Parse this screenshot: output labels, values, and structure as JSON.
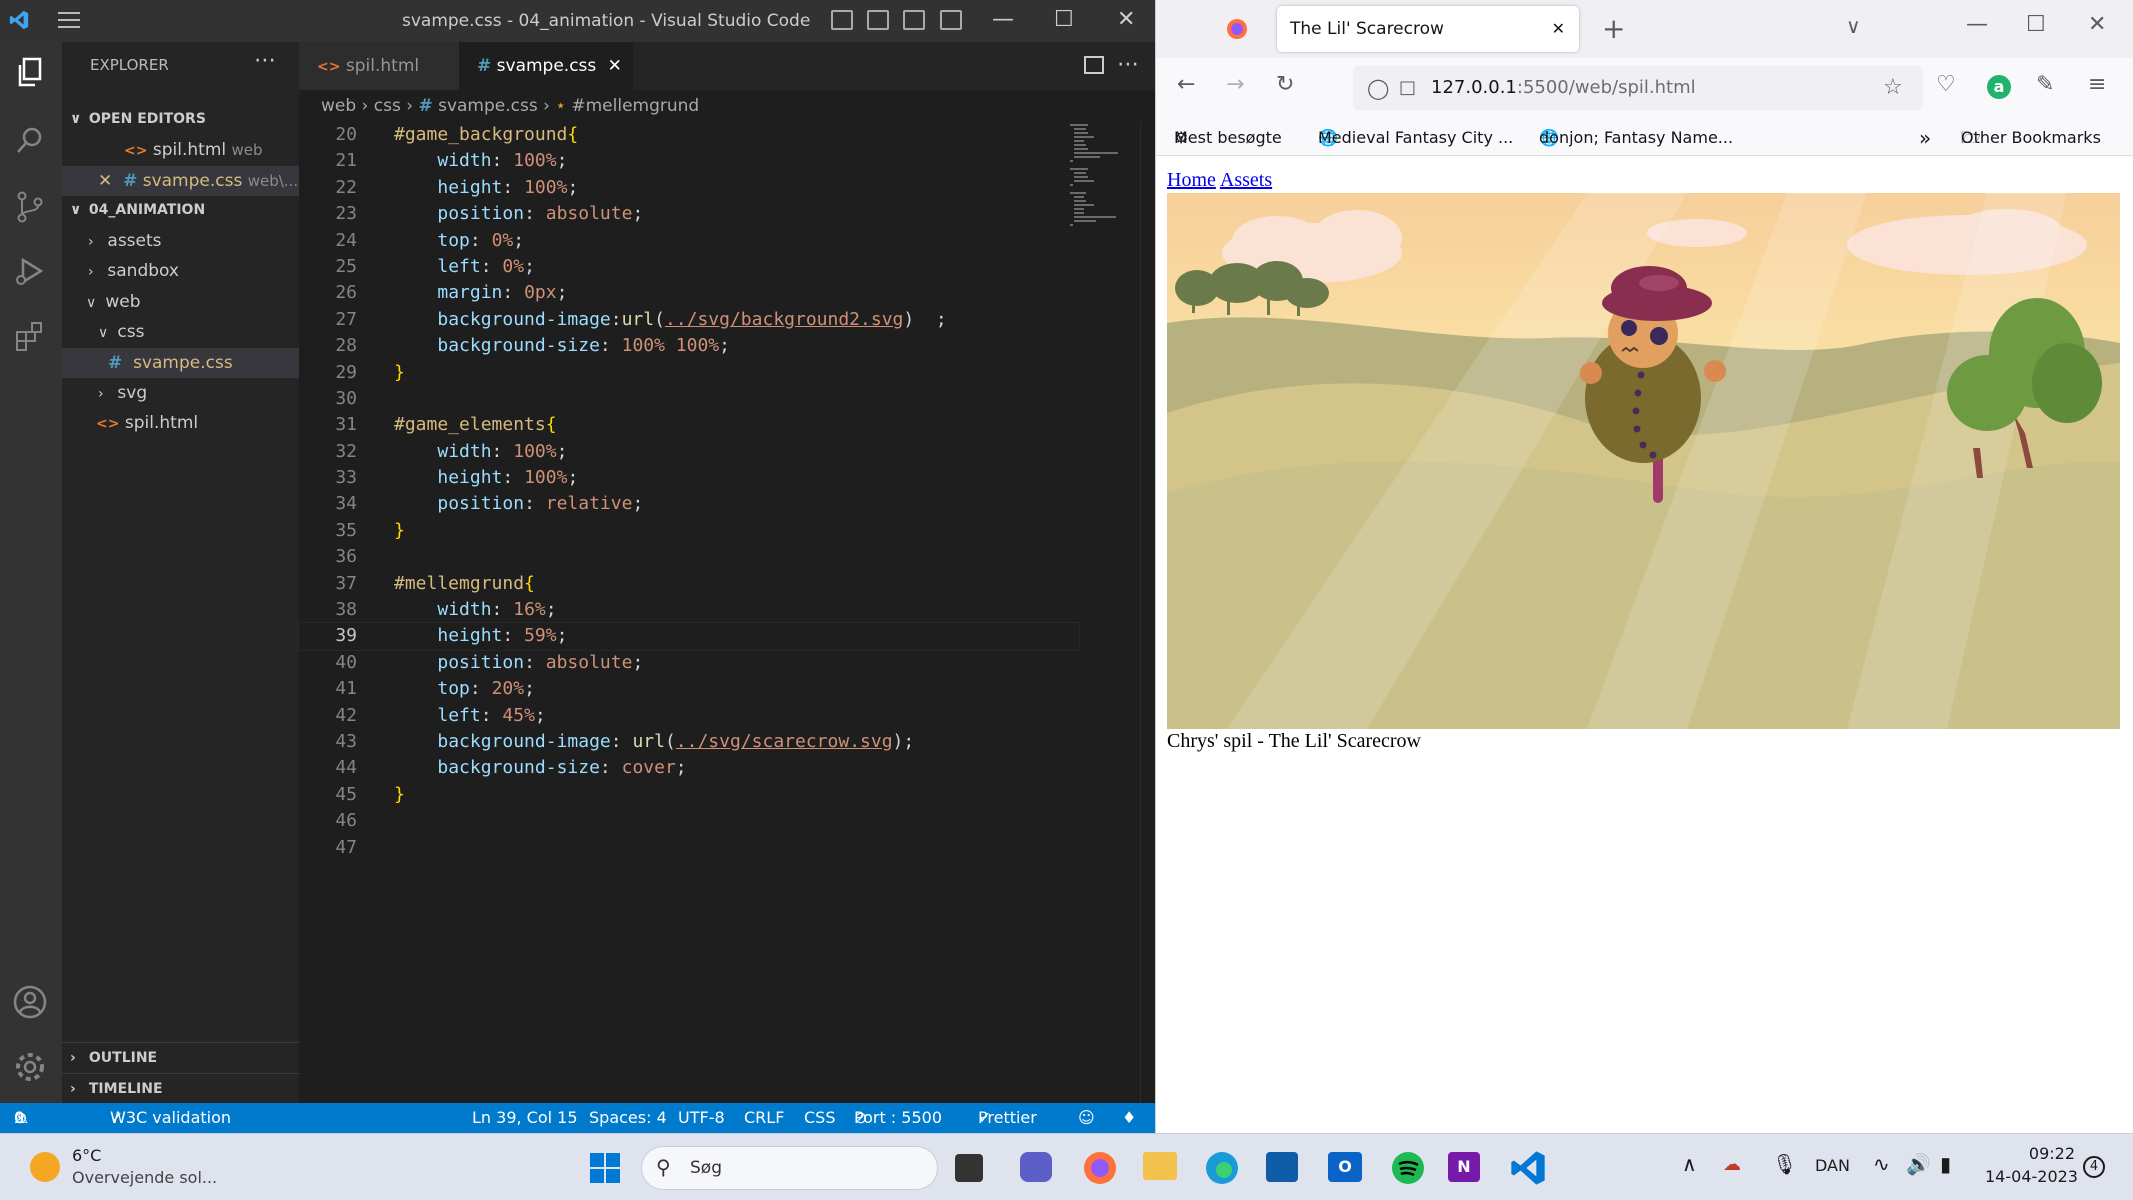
{
  "vscode": {
    "window_title": "svampe.css - 04_animation - Visual Studio Code",
    "explorer": {
      "header": "EXPLORER",
      "open_editors_label": "OPEN EDITORS",
      "open_editors": [
        {
          "name": "spil.html",
          "path": "web"
        },
        {
          "name": "svampe.css",
          "path": "web\\..."
        }
      ],
      "project_label": "04_ANIMATION",
      "tree": {
        "assets": "assets",
        "sandbox": "sandbox",
        "web": "web",
        "css": "css",
        "svampe": "svampe.css",
        "svg": "svg",
        "spil": "spil.html"
      },
      "outline_label": "OUTLINE",
      "timeline_label": "TIMELINE"
    },
    "tabs": [
      {
        "label": "spil.html"
      },
      {
        "label": "svampe.css"
      }
    ],
    "breadcrumb": [
      "web",
      "css",
      "svampe.css",
      "#mellemgrund"
    ],
    "code_lines": [
      {
        "n": "20",
        "t": "#game_background{"
      },
      {
        "n": "21",
        "t": "    width: 100%;"
      },
      {
        "n": "22",
        "t": "    height: 100%;"
      },
      {
        "n": "23",
        "t": "    position: absolute;"
      },
      {
        "n": "24",
        "t": "    top: 0%;"
      },
      {
        "n": "25",
        "t": "    left: 0%;"
      },
      {
        "n": "26",
        "t": "    margin: 0px;"
      },
      {
        "n": "27",
        "t": "    background-image:url(../svg/background2.svg)  ;"
      },
      {
        "n": "28",
        "t": "    background-size: 100% 100%;"
      },
      {
        "n": "29",
        "t": "}"
      },
      {
        "n": "30",
        "t": ""
      },
      {
        "n": "31",
        "t": "#game_elements{"
      },
      {
        "n": "32",
        "t": "    width: 100%;"
      },
      {
        "n": "33",
        "t": "    height: 100%;"
      },
      {
        "n": "34",
        "t": "    position: relative;"
      },
      {
        "n": "35",
        "t": "}"
      },
      {
        "n": "36",
        "t": ""
      },
      {
        "n": "37",
        "t": "#mellemgrund{"
      },
      {
        "n": "38",
        "t": "    width: 16%;"
      },
      {
        "n": "39",
        "t": "    height: 59%;"
      },
      {
        "n": "40",
        "t": "    position: absolute;"
      },
      {
        "n": "41",
        "t": "    top: 20%;"
      },
      {
        "n": "42",
        "t": "    left: 45%;"
      },
      {
        "n": "43",
        "t": "    background-image: url(../svg/scarecrow.svg);"
      },
      {
        "n": "44",
        "t": "    background-size: cover;"
      },
      {
        "n": "45",
        "t": "}"
      },
      {
        "n": "46",
        "t": ""
      },
      {
        "n": "47",
        "t": ""
      }
    ],
    "status": {
      "errors": "0",
      "warnings": "0",
      "w3c": "W3C validation",
      "position": "Ln 39, Col 15",
      "spaces": "Spaces: 4",
      "encoding": "UTF-8",
      "eol": "CRLF",
      "language": "CSS",
      "port": "Port : 5500",
      "prettier": "Prettier"
    }
  },
  "firefox": {
    "tab_title": "The Lil' Scarecrow",
    "url_host": "127.0.0.1",
    "url_rest": ":5500/web/spil.html",
    "bookmarks": [
      "Mest besøgte",
      "Medieval Fantasy City ...",
      "donjon; Fantasy Name..."
    ],
    "other_bookmarks": "Other Bookmarks",
    "page": {
      "links": [
        "Home",
        "Assets"
      ],
      "caption": "Chrys' spil - The Lil' Scarecrow"
    }
  },
  "taskbar": {
    "weather_temp": "6°C",
    "weather_desc": "Overvejende sol...",
    "search_placeholder": "Søg",
    "language": "DAN",
    "time": "09:22",
    "date": "14-04-2023",
    "notification_count": "4"
  }
}
